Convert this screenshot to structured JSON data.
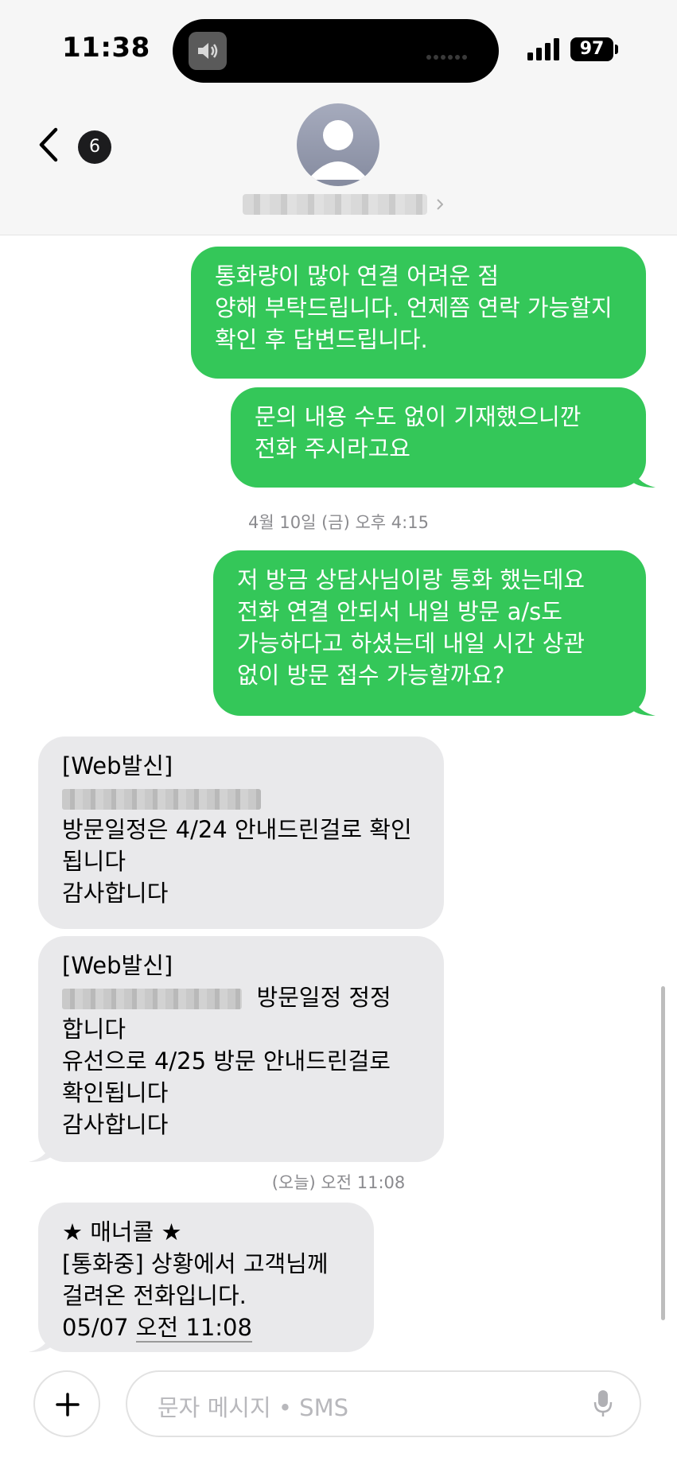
{
  "status_bar": {
    "time": "11:38",
    "battery": "97"
  },
  "nav": {
    "unread_count": "6"
  },
  "messages": [
    {
      "type": "sent",
      "lines": [
        "통화량이 많아 연결 어려운 점",
        "양해 부탁드립니다. 언제쯤 연락 가능할지",
        "확인 후 답변드립니다."
      ]
    },
    {
      "type": "sent",
      "lines": [
        "문의 내용 수도 없이 기재했으니깐",
        "전화 주시라고요"
      ]
    },
    {
      "type": "timestamp",
      "text": "4월 10일 (금) 오후 4:15"
    },
    {
      "type": "sent",
      "lines": [
        "저 방금 상담사님이랑 통화 했는데요",
        "전화 연결 안되서 내일 방문 a/s도",
        "가능하다고 하셨는데 내일 시간 상관",
        "없이 방문 접수 가능할까요?"
      ]
    },
    {
      "type": "received",
      "header": "[Web발신]",
      "lines": [
        "방문일정은 4/24 안내드린걸로 확인",
        "됩니다",
        "감사합니다"
      ]
    },
    {
      "type": "received",
      "header": "[Web발신]",
      "inline_after_redaction": "방문일정 정정",
      "lines": [
        "합니다",
        "유선으로 4/25 방문 안내드린걸로",
        "확인됩니다",
        "감사합니다"
      ]
    },
    {
      "type": "timestamp",
      "text": "(오늘) 오전 11:08"
    },
    {
      "type": "received",
      "lines": [
        " ★ 매너콜 ★",
        "[통화중] 상황에서 고객님께",
        "걸려온 전화입니다."
      ],
      "last_line_prefix": "05/07 ",
      "last_line_link": "오전 11:08"
    }
  ],
  "input": {
    "placeholder": "문자 메시지 • SMS"
  },
  "icons": [
    "speaker-icon",
    "signal-icon",
    "back-chevron-icon",
    "avatar-icon",
    "chevron-right-icon",
    "plus-icon",
    "microphone-icon"
  ],
  "colors": {
    "sent_bubble": "#34c759",
    "received_bubble": "#e9e9eb",
    "timestamp_text": "#8a8a8e"
  }
}
